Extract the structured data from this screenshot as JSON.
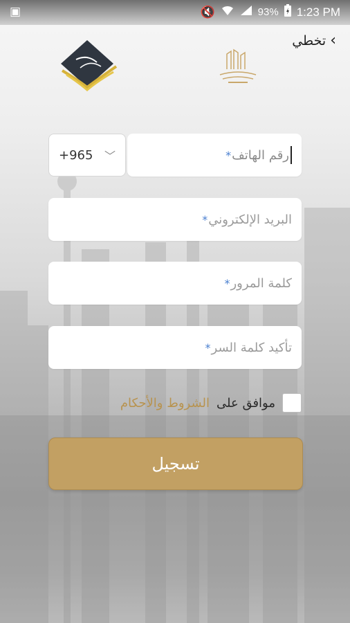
{
  "status_bar": {
    "battery_percent": "93%",
    "time": "1:23 PM"
  },
  "header": {
    "skip_label": "تخطي"
  },
  "form": {
    "phone": {
      "country_code": "+965",
      "placeholder": "رقم الهاتف",
      "required_mark": "*"
    },
    "email": {
      "placeholder": "البريد الإلكتروني",
      "required_mark": "*"
    },
    "password": {
      "placeholder": "كلمة المرور",
      "required_mark": "*"
    },
    "confirm_password": {
      "placeholder": "تأكيد كلمة السر",
      "required_mark": "*"
    },
    "agree": {
      "prefix": "موافق على",
      "terms_link": "الشروط والأحكام"
    },
    "register_label": "تسجيل"
  },
  "colors": {
    "accent_gold": "#c2a063",
    "required_blue": "#4a7fd0",
    "terms_gold": "#b8934f"
  }
}
